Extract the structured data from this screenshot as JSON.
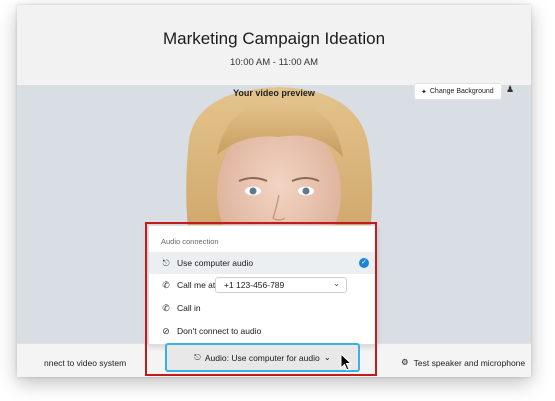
{
  "meeting": {
    "title": "Marketing Campaign Ideation",
    "time": "10:00 AM - 11:00 AM"
  },
  "preview": {
    "label": "Your video preview",
    "change_background_label": "Change Background",
    "change_background_icon": "magic-wand-icon",
    "more_icon": "accessibility-icon"
  },
  "bottom_bar": {
    "connect_video_label": "nnect to video system",
    "test_speaker_label": "Test speaker and microphone",
    "test_speaker_icon": "gear-icon"
  },
  "audio_popup": {
    "heading": "Audio connection",
    "options": [
      {
        "label": "Use computer audio",
        "icon": "headset-icon",
        "selected": true
      },
      {
        "label": "Call me at",
        "icon": "phone-outgoing-icon",
        "selected": false
      },
      {
        "label": "Call in",
        "icon": "phone-incoming-icon",
        "selected": false
      },
      {
        "label": "Don't connect to audio",
        "icon": "no-audio-icon",
        "selected": false
      }
    ],
    "phone_number": "+1 123-456-789"
  },
  "audio_button": {
    "label": "Audio: Use computer for audio",
    "icon": "headset-icon"
  },
  "colors": {
    "highlight_box": "#c21b1b",
    "focus_ring": "#39b0e6",
    "selected_check": "#1c84d8"
  }
}
